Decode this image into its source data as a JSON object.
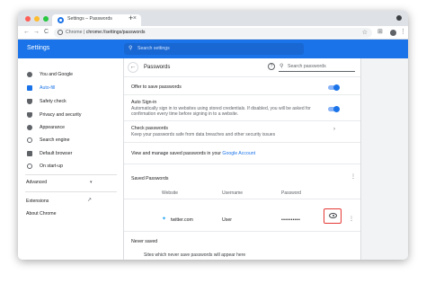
{
  "tab": {
    "title": "Settings – Passwords",
    "close": "×",
    "new_tab": "+"
  },
  "toolbar": {
    "back": "←",
    "forward": "→",
    "reload": "C",
    "url_chip": "Chrome",
    "url_divider": "|",
    "url": "chrome://settings/passwords",
    "star": "☆",
    "extensions": "⊞",
    "menu": "⋮"
  },
  "header": {
    "title": "Settings",
    "search_placeholder": "Search settings"
  },
  "sidebar": {
    "items": [
      {
        "label": "You and Google",
        "icon": "person-icon"
      },
      {
        "label": "Auto-fill",
        "icon": "autofill-icon",
        "active": true
      },
      {
        "label": "Safety check",
        "icon": "shield-icon"
      },
      {
        "label": "Privacy and security",
        "icon": "shield-lock-icon"
      },
      {
        "label": "Appearance",
        "icon": "palette-icon"
      },
      {
        "label": "Search engine",
        "icon": "search-icon"
      },
      {
        "label": "Default browser",
        "icon": "browser-icon"
      },
      {
        "label": "On start-up",
        "icon": "power-icon"
      }
    ],
    "advanced": "Advanced",
    "advanced_chevron": "▾",
    "extensions": "Extensions",
    "extensions_icon": "↗",
    "about": "About Chrome"
  },
  "passwords": {
    "back": "←",
    "title": "Passwords",
    "help": "?",
    "search_placeholder": "Search passwords",
    "offer_to_save": "Offer to save passwords",
    "auto_signin_title": "Auto Sign-in",
    "auto_signin_desc_1": "Automatically sign in to websites using stored credentials. If disabled, you will be asked for",
    "auto_signin_desc_2": "confirmation every time before signing in to a website.",
    "check_title": "Check passwords",
    "check_desc": "Keep your passwords safe from data breaches and other security issues",
    "check_arrow": "›",
    "manage_prefix": "View and manage saved passwords in your ",
    "manage_link": "Google Account",
    "saved_title": "Saved Passwords",
    "col_website": "Website",
    "col_username": "Username",
    "col_password": "Password",
    "entry": {
      "site": "twitter.com",
      "username": "User",
      "password": "••••••••••"
    },
    "kebab": "⋮",
    "never_saved_title": "Never saved",
    "never_saved_note": "Sites which never save passwords will appear here"
  }
}
